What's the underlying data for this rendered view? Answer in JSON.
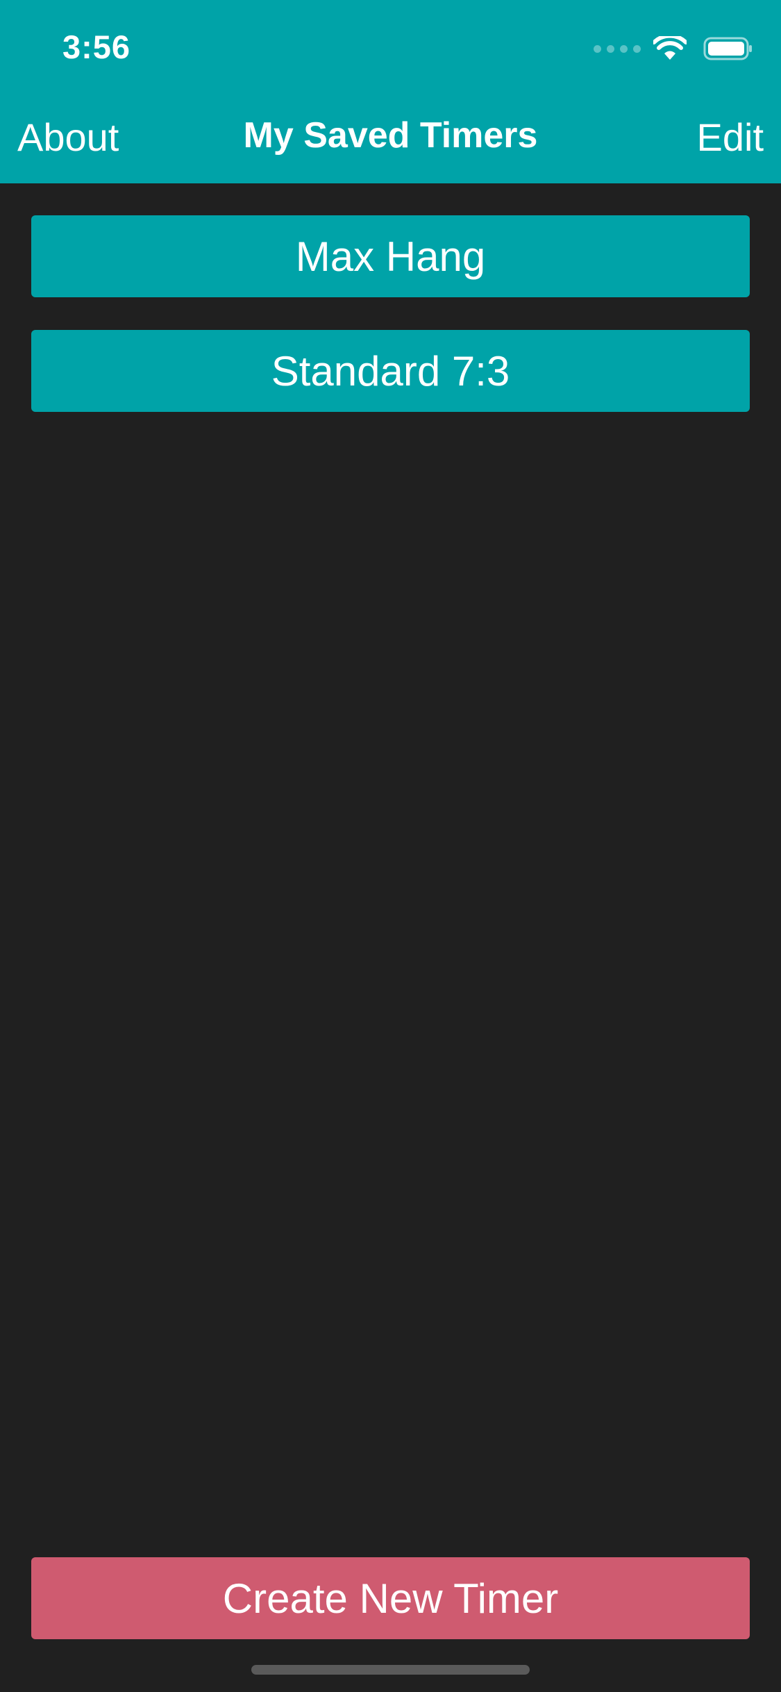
{
  "status_bar": {
    "time": "3:56",
    "icons": [
      "cellular-signal-icon",
      "wifi-icon",
      "battery-icon"
    ]
  },
  "nav_bar": {
    "left_label": "About",
    "title": "My Saved Timers",
    "right_label": "Edit"
  },
  "timers": [
    {
      "label": "Max Hang"
    },
    {
      "label": "Standard 7:3"
    }
  ],
  "create_button": {
    "label": "Create New Timer"
  },
  "colors": {
    "accent": "#00a3a8",
    "background": "#202020",
    "create": "#cf5b70"
  }
}
